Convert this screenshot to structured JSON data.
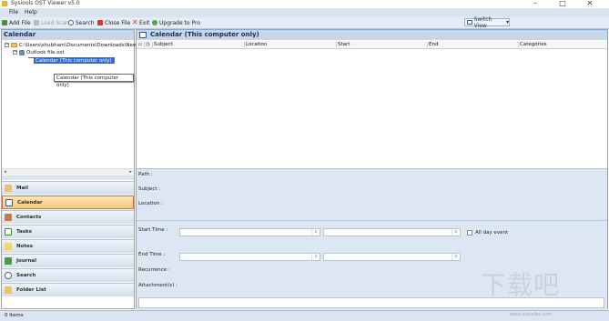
{
  "window": {
    "title": "Sysiools OST Viewer v5.0",
    "minimize": "–",
    "restore": "□",
    "close": "✕"
  },
  "menu": [
    "File",
    "Help"
  ],
  "toolbar": {
    "add_file": "Add File",
    "load_scan": "Load Scan",
    "search": "Search",
    "close_file": "Close File",
    "exit": "Exit",
    "upgrade": "Upgrade to Pro",
    "switch_view": "Switch View",
    "switch_view_arrow": "▾"
  },
  "left": {
    "header": "Calendar",
    "tree": {
      "root": "C:\\Users\\shubham\\Documents\\Downloads\\New",
      "file": "Outlook file.ost",
      "calendar": "Calendar (This computer only)"
    },
    "tooltip": "Calendar (This computer only)",
    "scroll_left": "◂",
    "scroll_right": "▸"
  },
  "nav": [
    "Mail",
    "Calendar",
    "Contacts",
    "Tasks",
    "Notes",
    "Journal",
    "Search",
    "Folder List"
  ],
  "right": {
    "header": "Calendar (This computer only)",
    "columns": [
      "Subject",
      "Location",
      "Start",
      "End",
      "Categories"
    ],
    "detail": {
      "path": "Path :",
      "subject": "Subject :",
      "location": "Location :",
      "start_time": "Start Time :",
      "all_day": "All day event",
      "end_time": "End Time :",
      "recurrence": "Recurrence :",
      "attachments": "Attachment(s) :"
    }
  },
  "status": {
    "items": "0 Items"
  },
  "watermark": "下载吧",
  "watermark_url": "www.xiazaiba.com",
  "colors": {
    "accent": "#c6d7ec",
    "active_nav": "#f8c97a",
    "selection": "#2e6dcf"
  }
}
